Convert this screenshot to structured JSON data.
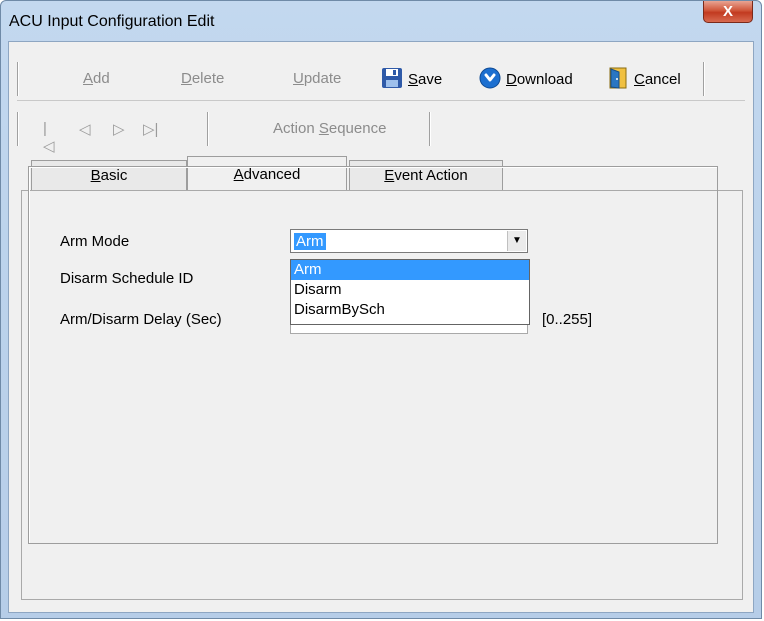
{
  "window": {
    "title": "ACU Input Configuration Edit",
    "close_label": "X"
  },
  "toolbar": {
    "add": {
      "prefix": "",
      "accel": "A",
      "rest": "dd"
    },
    "delete": {
      "prefix": "",
      "accel": "D",
      "rest": "elete"
    },
    "update": {
      "prefix": "",
      "accel": "U",
      "rest": "pdate"
    },
    "save": {
      "prefix": "",
      "accel": "S",
      "rest": "ave"
    },
    "download": {
      "prefix": "",
      "accel": "D",
      "rest": "ownload"
    },
    "cancel": {
      "prefix": "",
      "accel": "C",
      "rest": "ancel"
    },
    "nav_first": "|◁",
    "nav_prev": "◁",
    "nav_next": "▷",
    "nav_last": "▷|",
    "action_sequence": {
      "prefix": "Action ",
      "accel": "S",
      "rest": "equence"
    }
  },
  "tabs": [
    {
      "accel": "B",
      "rest": "asic"
    },
    {
      "accel": "A",
      "rest": "dvanced"
    },
    {
      "accel": "E",
      "rest": "vent Action"
    }
  ],
  "form": {
    "arm_mode_label": "Arm Mode",
    "disarm_schedule_label": "Disarm Schedule ID",
    "delay_label": "Arm/Disarm Delay (Sec)",
    "arm_mode_value": "Arm",
    "arm_mode_options": [
      "Arm",
      "Disarm",
      "DisarmBySch"
    ],
    "delay_range": "[0..255]"
  },
  "colors": {
    "selection": "#3399ff",
    "save_icon": "#2f5aa8",
    "download_icon": "#1c6fd0",
    "cancel_icon": "#2a76c2"
  }
}
